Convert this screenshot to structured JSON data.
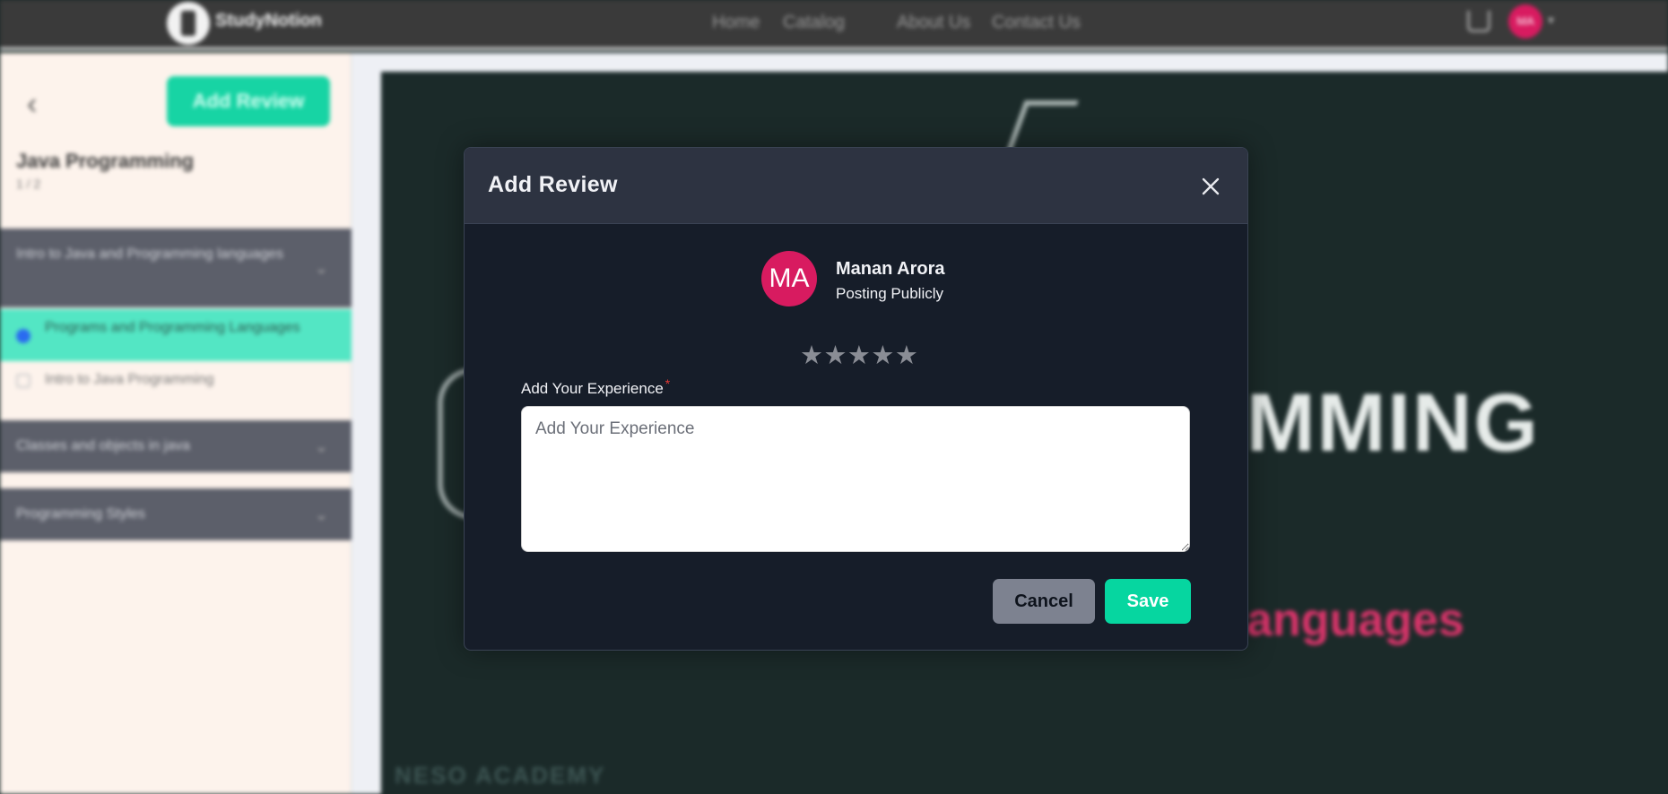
{
  "background": {
    "navbar": {
      "logo_text": "StudyNotion",
      "links": [
        "Home",
        "Catalog",
        "About Us",
        "Contact Us"
      ],
      "avatar_initials": "MA"
    },
    "sidebar": {
      "add_review_label": "Add Review",
      "course_title": "Java Programming",
      "progress": "1 / 2",
      "sections": [
        {
          "title": "Intro to Java and Programming languages"
        },
        {
          "title": "Classes and objects in java"
        },
        {
          "title": "Programming Styles"
        }
      ],
      "subsections": [
        {
          "title": "Programs and Programming Languages",
          "active": true
        },
        {
          "title": "Intro to Java Programming",
          "active": false
        }
      ]
    },
    "video": {
      "big_text": "MMING",
      "pink_text": "anguages",
      "watermark": "NESO ACADEMY"
    }
  },
  "modal": {
    "title": "Add Review",
    "user": {
      "initials": "MA",
      "name": "Manan Arora",
      "subtitle": "Posting Publicly",
      "avatar_color": "#d81b60"
    },
    "rating": {
      "max": 5,
      "value": 0,
      "star_char": "★"
    },
    "experience": {
      "label": "Add Your Experience",
      "required_mark": "*",
      "placeholder": "Add Your Experience",
      "value": ""
    },
    "cancel_label": "Cancel",
    "save_label": "Save",
    "accent_color": "#06d6a0"
  }
}
